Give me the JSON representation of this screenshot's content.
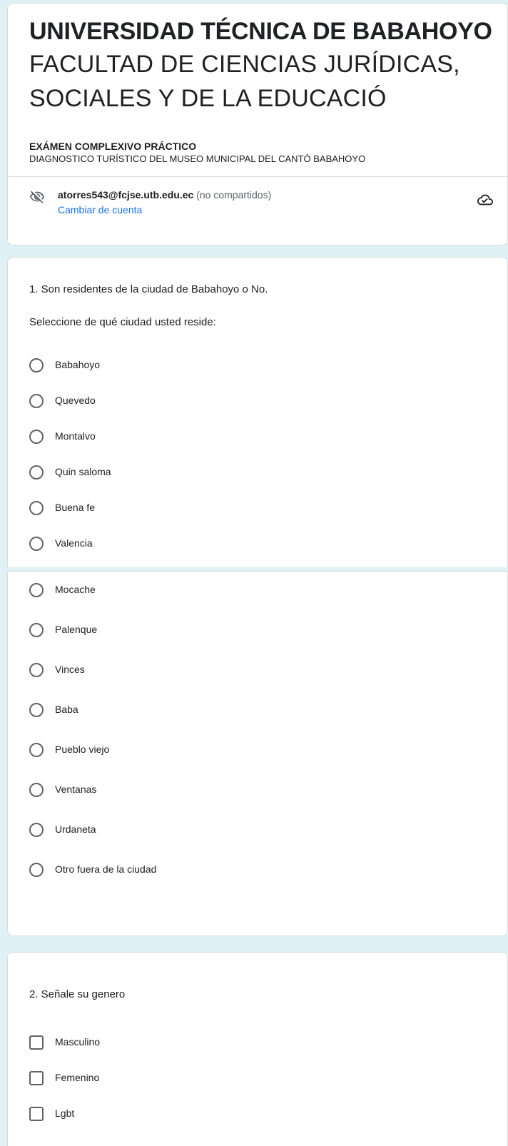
{
  "header": {
    "title_bold": "UNIVERSIDAD TÉCNICA DE BABAHOYO",
    "title_line_2": "FACULTAD DE CIENCIAS JURÍDICAS,",
    "title_line_3": "SOCIALES Y DE LA EDUCACIÓ",
    "section_heading": "EXÁMEN COMPLEXIVO PRÁCTICO",
    "section_description": "DIAGNOSTICO TURÍSTICO DEL MUSEO MUNICIPAL DEL CANTÓ BABAHOYO",
    "account_email": "atorres543@fcjse.utb.edu.ec",
    "account_note": "(no compartidos)",
    "switch_account": "Cambiar de cuenta",
    "icons": {
      "hidden": "eye-off-icon",
      "saved": "cloud-done-icon"
    }
  },
  "question_1": {
    "title": "1. Son residentes de la ciudad de Babahoyo o No.",
    "subtitle": "Seleccione de qué ciudad usted reside:",
    "options_part1": [
      "Babahoyo",
      "Quevedo",
      "Montalvo",
      "Quin saloma",
      "Buena fe",
      "Valencia"
    ],
    "options_part2": [
      "Mocache",
      "Palenque",
      "Vinces",
      "Baba",
      "Pueblo viejo",
      "Ventanas",
      "Urdaneta",
      "Otro fuera de la ciudad"
    ]
  },
  "question_2": {
    "title": "2. Señale su genero",
    "options": [
      "Masculino",
      "Femenino",
      "Lgbt"
    ]
  },
  "colors": {
    "background": "#dff1f5",
    "link": "#1a73e8",
    "text": "#202124"
  }
}
